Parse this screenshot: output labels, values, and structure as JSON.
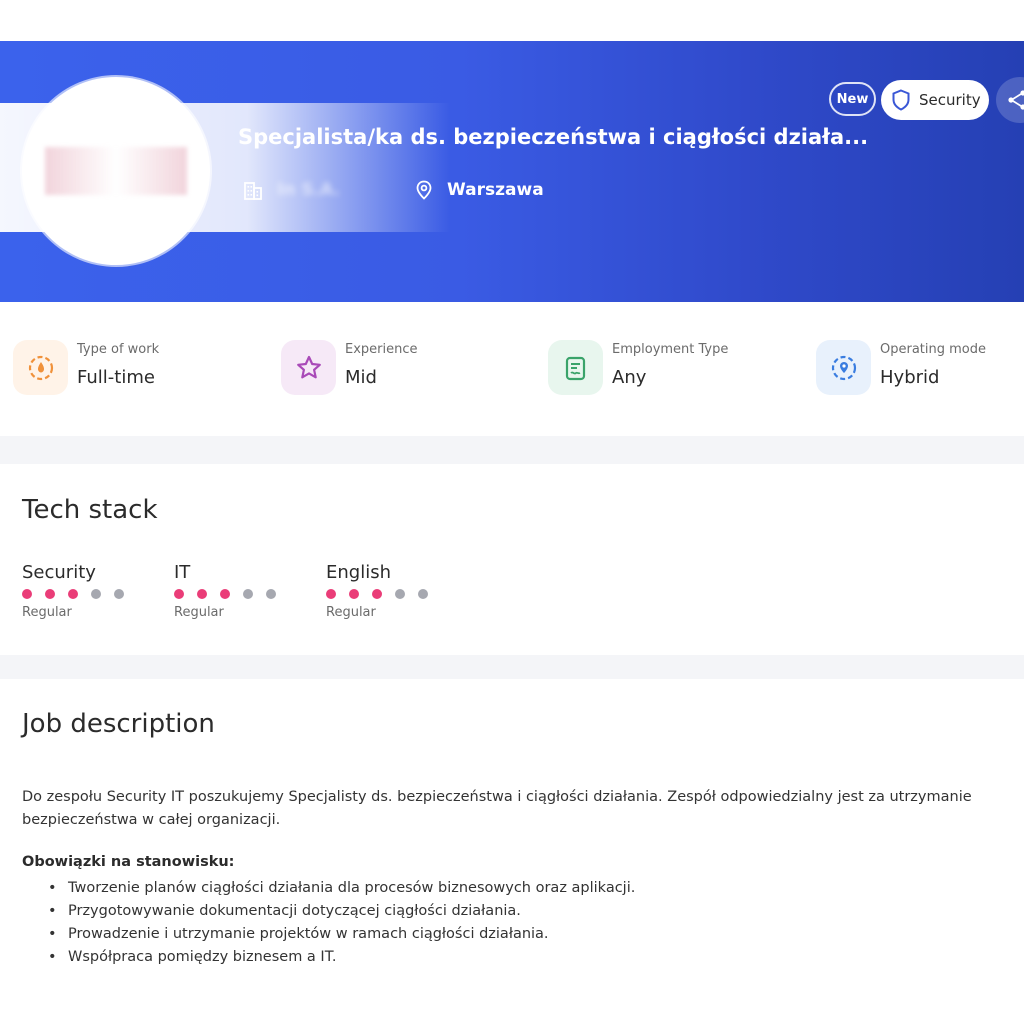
{
  "hero": {
    "title": "Specjalista/ka ds. bezpieczeństwa i ciągłości działa...",
    "company": "In        S.A.",
    "location": "Warszawa",
    "badge_new": "New",
    "badge_category": "Security",
    "colors": {
      "gradient_start": "#3b62ec",
      "gradient_end": "#2540b4"
    }
  },
  "attributes": [
    {
      "label": "Type of work",
      "value": "Full-time",
      "icon": "clock-icon"
    },
    {
      "label": "Experience",
      "value": "Mid",
      "icon": "star-icon"
    },
    {
      "label": "Employment Type",
      "value": "Any",
      "icon": "contract-icon"
    },
    {
      "label": "Operating mode",
      "value": "Hybrid",
      "icon": "location-pin-icon"
    }
  ],
  "tech_stack": {
    "title": "Tech stack",
    "skills": [
      {
        "name": "Security",
        "level": "Regular",
        "filled": 3,
        "total": 5
      },
      {
        "name": "IT",
        "level": "Regular",
        "filled": 3,
        "total": 5
      },
      {
        "name": "English",
        "level": "Regular",
        "filled": 3,
        "total": 5
      }
    ],
    "colors": {
      "dot_on": "#ea3d78",
      "dot_off": "#a6a8b0"
    }
  },
  "job_description": {
    "title": "Job description",
    "intro": "Do zespołu Security IT poszukujemy Specjalisty ds. bezpieczeństwa i ciągłości działania. Zespół odpowiedzialny jest za utrzymanie bezpieczeństwa w całej organizacji.",
    "duties_title": "Obowiązki na stanowisku:",
    "duties": [
      "Tworzenie planów ciągłości działania dla procesów biznesowych oraz aplikacji.",
      "Przygotowywanie dokumentacji dotyczącej ciągłości działania.",
      "Prowadzenie i utrzymanie projektów w ramach ciągłości działania.",
      "Współpraca pomiędzy biznesem a IT."
    ]
  }
}
